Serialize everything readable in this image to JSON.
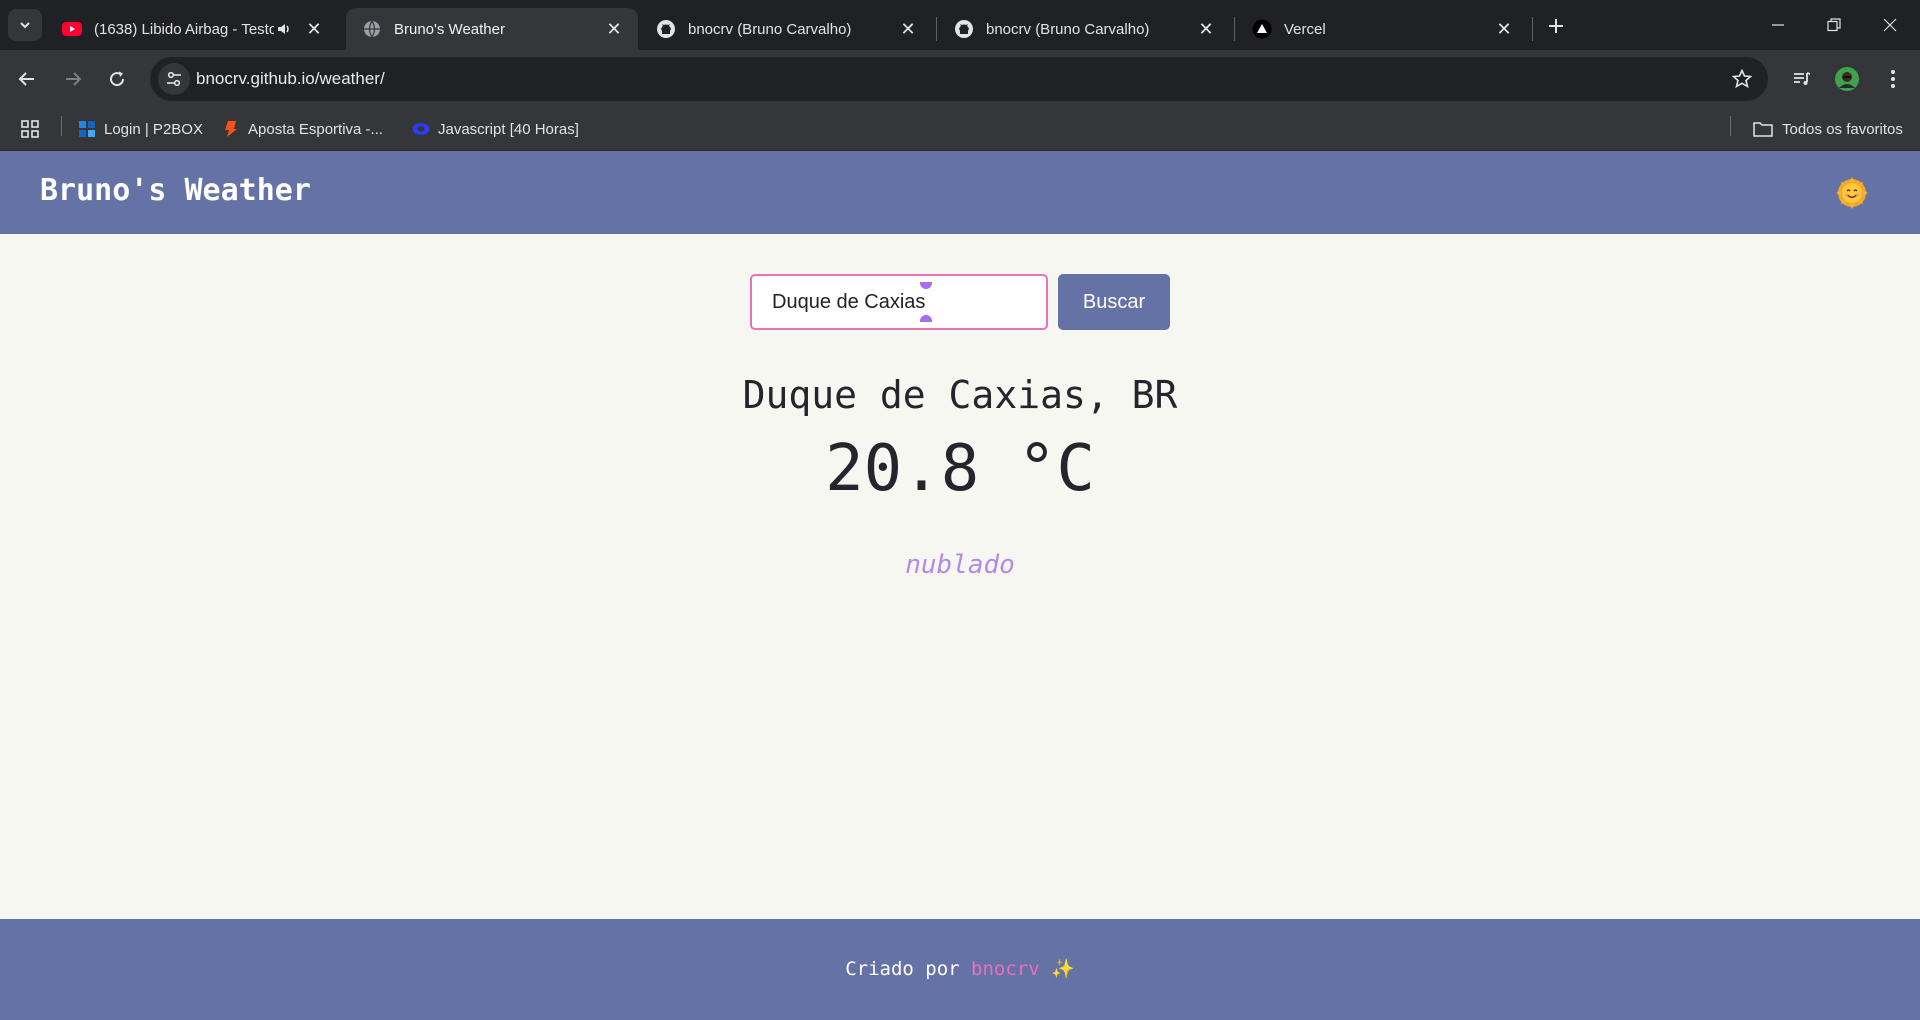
{
  "browser": {
    "tabs": [
      {
        "title": "(1638) Libido Airbag - Testo",
        "icon": "youtube-icon",
        "audio": true
      },
      {
        "title": "Bruno's Weather",
        "icon": "globe-icon",
        "active": true
      },
      {
        "title": "bnocrv (Bruno Carvalho)",
        "icon": "github-icon"
      },
      {
        "title": "bnocrv (Bruno Carvalho)",
        "icon": "github-icon"
      },
      {
        "title": "Vercel",
        "icon": "vercel-icon"
      }
    ],
    "url": "bnocrv.github.io/weather/",
    "bookmarks": [
      {
        "label": "Login | P2BOX",
        "icon": "p2box-icon"
      },
      {
        "label": "Aposta Esportiva -...",
        "icon": "betting-icon"
      },
      {
        "label": "Javascript [40 Horas]",
        "icon": "course-icon"
      }
    ],
    "all_bookmarks_label": "Todos os favoritos"
  },
  "app": {
    "title": "Bruno's Weather",
    "theme_icon": "sun-emoji",
    "search": {
      "value": "Duque de Caxias",
      "button_label": "Buscar"
    },
    "weather": {
      "location": "Duque de Caxias, BR",
      "temperature": "20.8 °C",
      "description": "nublado"
    },
    "footer": {
      "prefix": "Criado por",
      "author": "bnocrv",
      "emoji": "✨"
    }
  },
  "colors": {
    "header_bg": "#6472a6",
    "page_bg": "#f7f7f2",
    "accent_pink": "#ec6fb9",
    "description_purple": "#b48ae8"
  }
}
